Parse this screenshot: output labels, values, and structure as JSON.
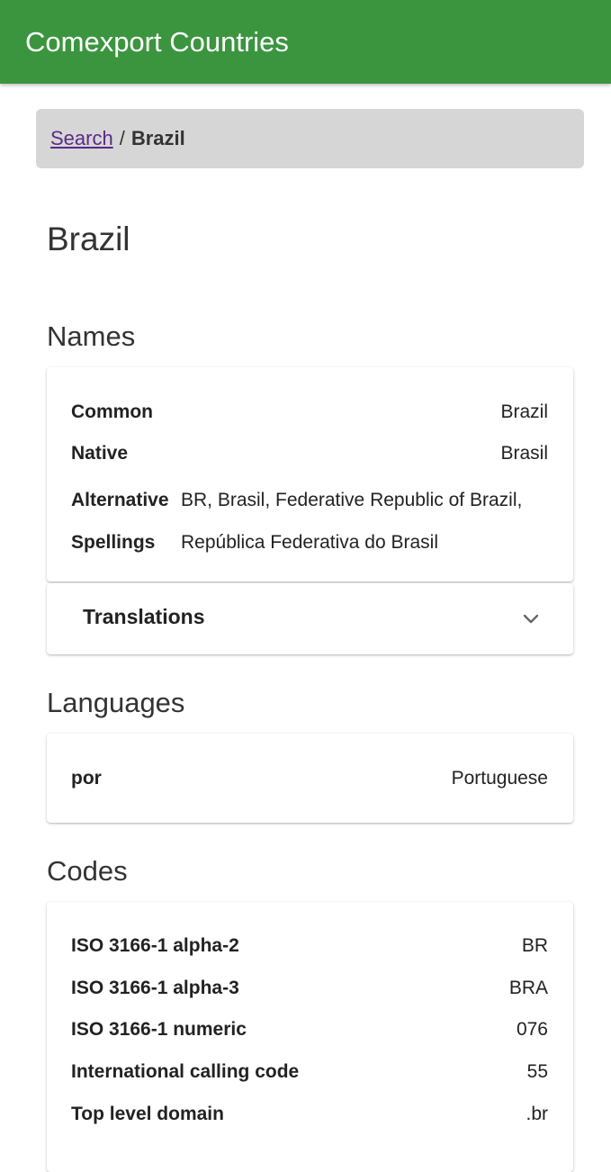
{
  "app": {
    "title": "Comexport Countries"
  },
  "breadcrumb": {
    "link_label": "Search",
    "separator": "/",
    "current": "Brazil"
  },
  "page": {
    "title": "Brazil"
  },
  "names": {
    "heading": "Names",
    "common_label": "Common",
    "common_value": "Brazil",
    "native_label": "Native",
    "native_value": "Brasil",
    "alt_label_line1": "Alternative",
    "alt_label_line2": "Spellings",
    "alt_value_line1": "BR, Brasil, Federative Republic of Brazil,",
    "alt_value_line2": "República Federativa do Brasil"
  },
  "translations": {
    "label": "Translations",
    "expanded": false,
    "icon": "chevron-down-icon"
  },
  "languages": {
    "heading": "Languages",
    "items": [
      {
        "code": "por",
        "name": "Portuguese"
      }
    ]
  },
  "codes": {
    "heading": "Codes",
    "items": [
      {
        "label": "ISO 3166-1 alpha-2",
        "value": "BR"
      },
      {
        "label": "ISO 3166-1 alpha-3",
        "value": "BRA"
      },
      {
        "label": "ISO 3166-1 numeric",
        "value": "076"
      },
      {
        "label": "International calling code",
        "value": "55"
      },
      {
        "label": "Top level domain",
        "value": ".br"
      }
    ]
  },
  "colors": {
    "appbar": "#3b953f",
    "breadcrumb_bg": "#d6d6d6",
    "link": "#5b2a86"
  }
}
